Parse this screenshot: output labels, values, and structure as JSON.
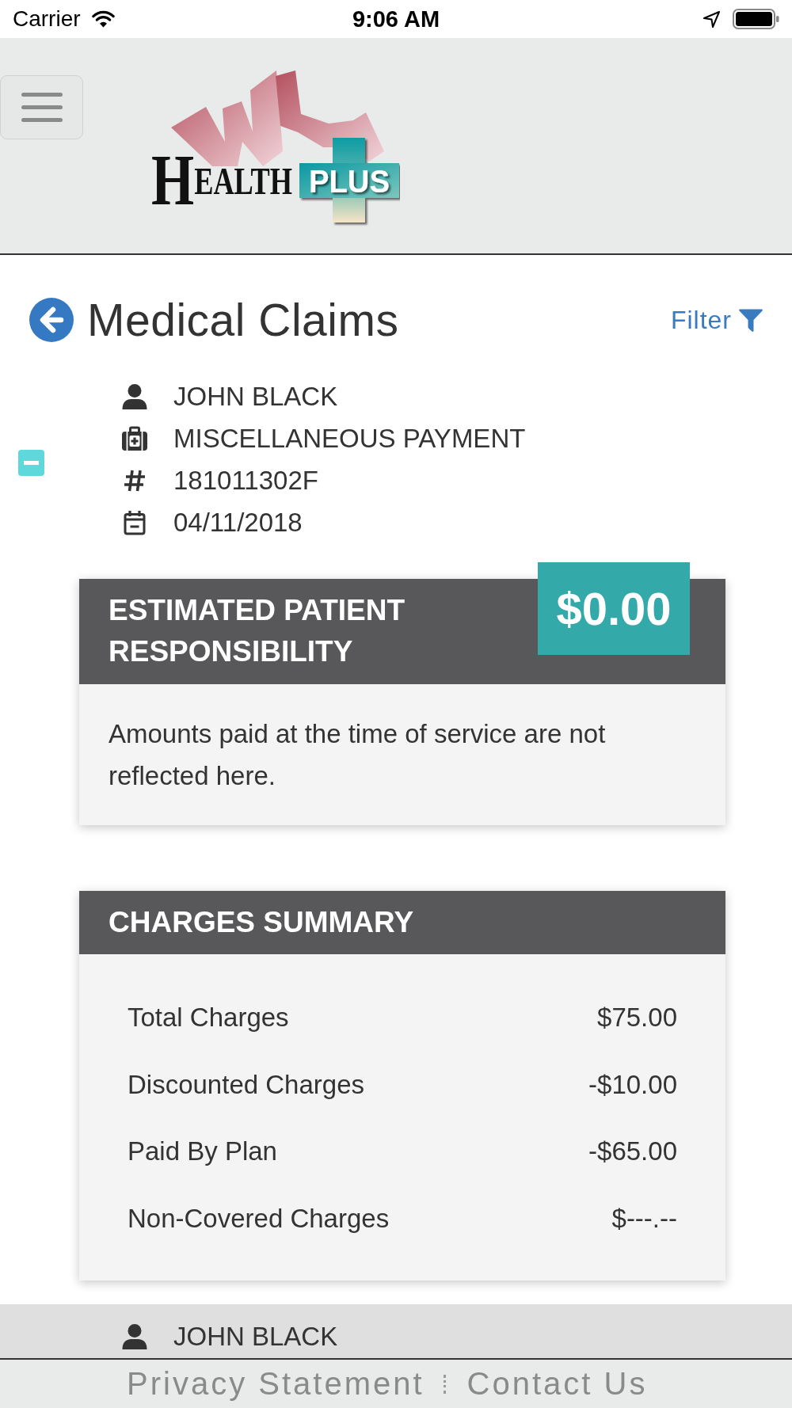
{
  "status_bar": {
    "carrier": "Carrier",
    "time": "9:06 AM"
  },
  "header": {
    "logo": {
      "wordmark": "HEALTH",
      "cross_text": "PLUS"
    }
  },
  "page": {
    "title": "Medical Claims",
    "filter": "Filter"
  },
  "claim": {
    "expanded": true,
    "details": [
      {
        "kind": "member",
        "text": "JOHN BLACK"
      },
      {
        "kind": "service",
        "text": "MISCELLANEOUS PAYMENT"
      },
      {
        "kind": "number",
        "text": "181011302F"
      },
      {
        "kind": "date",
        "text": "04/11/2018"
      }
    ]
  },
  "responsibility_card": {
    "title": "ESTIMATED PATIENT RESPONSIBILITY",
    "amount": "$0.00",
    "note": "Amounts paid at the time of service are not reflected here."
  },
  "charges_card": {
    "title": "CHARGES SUMMARY",
    "rows": [
      {
        "label": "Total Charges",
        "value": "$75.00"
      },
      {
        "label": "Discounted Charges",
        "value": "-$10.00"
      },
      {
        "label": "Paid By Plan",
        "value": "-$65.00"
      },
      {
        "label": "Non-Covered Charges",
        "value": "$---.--"
      }
    ]
  },
  "next_claim": {
    "details": [
      {
        "kind": "member",
        "text": "JOHN BLACK"
      }
    ]
  },
  "footer": {
    "links": [
      "Privacy Statement",
      "Contact Us"
    ]
  }
}
